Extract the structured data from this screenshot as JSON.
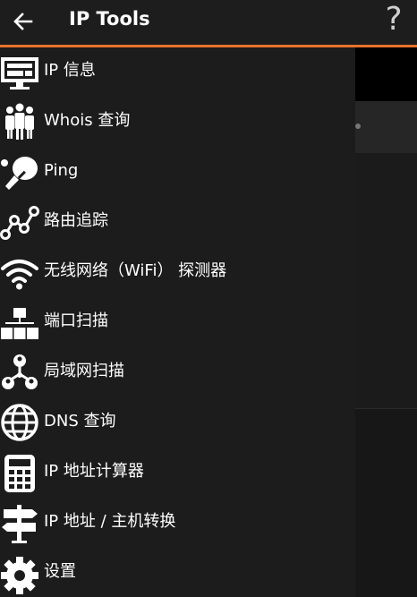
{
  "appbar": {
    "title": "IP Tools",
    "help_label": "?",
    "accent_color": "#e8742b"
  },
  "menu": {
    "items": [
      {
        "label": "IP 信息",
        "icon": "monitor-icon"
      },
      {
        "label": "Whois 查询",
        "icon": "people-icon"
      },
      {
        "label": "Ping",
        "icon": "ping-pong-icon"
      },
      {
        "label": "路由追踪",
        "icon": "route-icon"
      },
      {
        "label": "无线网络（WiFi） 探测器",
        "icon": "wifi-icon"
      },
      {
        "label": "端口扫描",
        "icon": "network-blocks-icon"
      },
      {
        "label": "局域网扫描",
        "icon": "lan-users-icon"
      },
      {
        "label": "DNS 查询",
        "icon": "globe-icon"
      },
      {
        "label": "IP 地址计算器",
        "icon": "calculator-icon"
      },
      {
        "label": "IP 地址 / 主机转换",
        "icon": "signpost-icon"
      },
      {
        "label": "设置",
        "icon": "gear-icon"
      }
    ]
  }
}
